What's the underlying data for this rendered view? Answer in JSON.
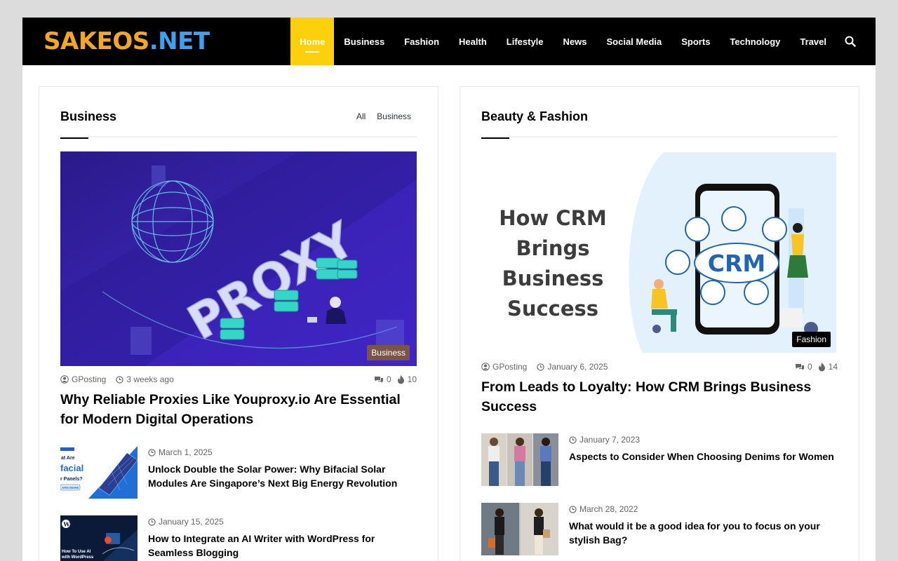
{
  "header": {
    "logo_part1": "SAKEOS",
    "logo_part2": ".NET",
    "nav": [
      "Home",
      "Business",
      "Fashion",
      "Health",
      "Lifestyle",
      "News",
      "Social Media",
      "Sports",
      "Technology",
      "Travel"
    ],
    "active_nav": "Home",
    "search_icon": "search-icon"
  },
  "colors": {
    "accent": "#fcd00a",
    "logo_orange": "#f5a623",
    "logo_blue": "#3ea0f0",
    "business_badge": "#7a5544",
    "fashion_badge": "#000000"
  },
  "business": {
    "title": "Business",
    "tabs": [
      "All",
      "Business"
    ],
    "hero": {
      "image_text": "PROXY",
      "badge": "Business",
      "author": "GPosting",
      "date": "3 weeks ago",
      "comments": "0",
      "views": "10",
      "title": "Why Reliable Proxies Like Youproxy.io Are Essential for Modern Digital Operations"
    },
    "items": [
      {
        "date": "March 1, 2025",
        "title": "Unlock Double the Solar Power: Why Bifacial Solar Modules Are Singapore’s Next Big Energy Revolution",
        "thumb_text": [
          "at Are",
          "facial",
          "r Panels?",
          "ARN MORE"
        ]
      },
      {
        "date": "January 15, 2025",
        "title": "How to Integrate an AI Writer with WordPress for Seamless Blogging",
        "thumb_text": [
          "How To Use AI",
          "with WordPress"
        ]
      }
    ]
  },
  "fashion": {
    "title": "Beauty & Fashion",
    "hero": {
      "image_lines": [
        "How CRM",
        "Brings",
        "Business",
        "Success"
      ],
      "image_badge_text": "CRM",
      "badge": "Fashion",
      "author": "GPosting",
      "date": "January 6, 2025",
      "comments": "0",
      "views": "14",
      "title": "From Leads to Loyalty: How CRM Brings Business Success"
    },
    "items": [
      {
        "date": "January 7, 2023",
        "title": "Aspects to Consider When Choosing Denims for Women"
      },
      {
        "date": "March 28, 2022",
        "title": "What would it be a good idea for you to focus on your stylish Bag?"
      }
    ]
  }
}
